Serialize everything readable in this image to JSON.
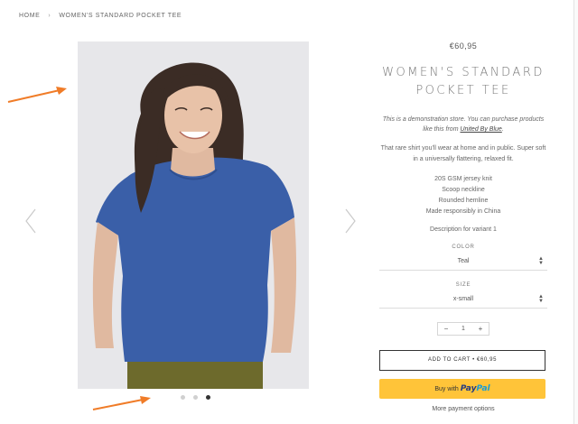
{
  "breadcrumb": {
    "home": "HOME",
    "separator": "›",
    "current": "WOMEN'S STANDARD POCKET TEE"
  },
  "product": {
    "price": "€60,95",
    "title_line1": "WOMEN'S STANDARD",
    "title_line2": "POCKET TEE",
    "demo_text": "This is a demonstration store. You can purchase products like this from",
    "demo_link": "United By Blue",
    "demo_end": ".",
    "description": "That rare shirt you'll wear at home and in public. Super soft in a universally flattering, relaxed fit.",
    "specs": [
      "20S GSM jersey knit",
      "Scoop neckline",
      "Rounded hemline",
      "Made responsibly in China"
    ],
    "variant_description": "Description for variant 1"
  },
  "options": {
    "color_label": "COLOR",
    "color_value": "Teal",
    "size_label": "SIZE",
    "size_value": "x-small"
  },
  "quantity": {
    "minus": "−",
    "value": "1",
    "plus": "+"
  },
  "actions": {
    "add_to_cart": "ADD TO CART • €60,95",
    "paypal_prefix": "Buy with",
    "paypal_brand_1": "Pay",
    "paypal_brand_2": "Pal",
    "more_payment": "More payment options"
  },
  "gallery": {
    "dot_count": 3,
    "active_dot": 3
  },
  "colors": {
    "accent_annotation": "#f07c28",
    "paypal_yellow": "#ffc439",
    "shirt_blue": "#3a5fa8",
    "pants_olive": "#6d6a2c"
  }
}
